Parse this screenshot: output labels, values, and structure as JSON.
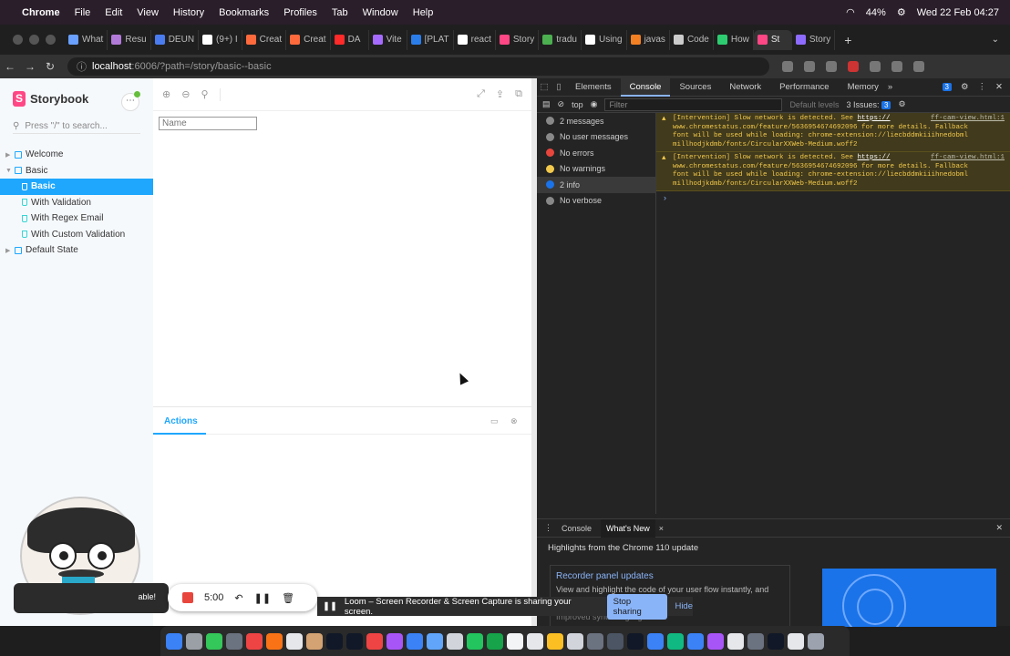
{
  "menubar": {
    "app": "Chrome",
    "items": [
      "File",
      "Edit",
      "View",
      "History",
      "Bookmarks",
      "Profiles",
      "Tab",
      "Window",
      "Help"
    ],
    "battery": "44%",
    "datetime": "Wed 22 Feb  04:27"
  },
  "tabs": [
    {
      "label": "What",
      "color": "#6aa0ff"
    },
    {
      "label": "Resu",
      "color": "#b27ad8"
    },
    {
      "label": "DEUN",
      "color": "#4a7cf0"
    },
    {
      "label": "(9+) I",
      "color": "#ffffff"
    },
    {
      "label": "Creat",
      "color": "#ff6a3d"
    },
    {
      "label": "Creat",
      "color": "#ff6a3d"
    },
    {
      "label": "DA",
      "color": "#ff2a2a"
    },
    {
      "label": "Vite",
      "color": "#a56bff"
    },
    {
      "label": "[PLAT",
      "color": "#2b7de9"
    },
    {
      "label": "react",
      "color": "#ffffff"
    },
    {
      "label": "Story",
      "color": "#ff4785"
    },
    {
      "label": "tradu",
      "color": "#4caf50"
    },
    {
      "label": "Using",
      "color": "#ffffff"
    },
    {
      "label": "javas",
      "color": "#f48024"
    },
    {
      "label": "Code",
      "color": "#cccccc"
    },
    {
      "label": "How",
      "color": "#2ecc71"
    },
    {
      "label": "St",
      "color": "#ff4785",
      "active": true
    },
    {
      "label": "Story",
      "color": "#8e6bff"
    }
  ],
  "address": {
    "host": "localhost",
    "rest": ":6006/?path=/story/basic--basic"
  },
  "storybook": {
    "brand": "Storybook",
    "search_placeholder": "Press \"/\" to search...",
    "tree": [
      {
        "label": "Welcome",
        "level": 0
      },
      {
        "label": "Basic",
        "level": 0,
        "open": true
      },
      {
        "label": "Basic",
        "level": 1,
        "selected": true
      },
      {
        "label": "With Validation",
        "level": 1
      },
      {
        "label": "With Regex Email",
        "level": 1
      },
      {
        "label": "With Custom Validation",
        "level": 1
      },
      {
        "label": "Default State",
        "level": 0
      }
    ],
    "name_placeholder": "Name",
    "addons_tab": "Actions"
  },
  "devtools": {
    "tabs": [
      "Elements",
      "Console",
      "Sources",
      "Network",
      "Performance",
      "Memory"
    ],
    "active_tab": "Console",
    "badge_count": "3",
    "context": "top",
    "filter_placeholder": "Filter",
    "levels": "Default levels",
    "issues": "3 Issues:",
    "issues_count": "3",
    "sidebar": [
      {
        "label": "2 messages",
        "icon": "#888"
      },
      {
        "label": "No user messages",
        "icon": "#888"
      },
      {
        "label": "No errors",
        "icon": "#e8453c"
      },
      {
        "label": "No warnings",
        "icon": "#f2c94c"
      },
      {
        "label": "2 info",
        "icon": "#1a73e8"
      },
      {
        "label": "No verbose",
        "icon": "#888"
      }
    ],
    "logs": [
      {
        "line1": "[Intervention] Slow network is detected. See ",
        "link": "https://",
        "src": "ff-cam-view.html:1",
        "line2": "www.chromestatus.com/feature/5636954674692096 for more details. Fallback",
        "line3": "font will be used while loading: chrome-extension://liecbddmkiiihnedobml",
        "line4": "millhodjkdmb/fonts/CircularXXWeb-Medium.woff2"
      },
      {
        "line1": "[Intervention] Slow network is detected. See ",
        "link": "https://",
        "src": "ff-cam-view.html:1",
        "line2": "www.chromestatus.com/feature/5636954674692096 for more details. Fallback",
        "line3": "font will be used while loading: chrome-extension://liecbddmkiiihnedobml",
        "line4": "millhodjkdmb/fonts/CircularXXWeb-Medium.woff2"
      }
    ],
    "drawer_tabs": [
      "Console",
      "What's New"
    ],
    "drawer_active": "What's New",
    "highlights": "Highlights from the Chrome 110 update",
    "card_title": "Recorder panel updates",
    "card_desc": "View and highlight the code of your user flow instantly, and",
    "card_next": "Improved syntax highlights"
  },
  "recorder": {
    "time": "5:00",
    "mascot_label": "able!"
  },
  "share": {
    "message": "Loom – Screen Recorder & Screen Capture is sharing your screen.",
    "stop": "Stop sharing",
    "hide": "Hide"
  },
  "dock_colors": [
    "#3b82f6",
    "#9aa0a6",
    "#34c759",
    "#6b7280",
    "#ef4444",
    "#f97316",
    "#e5e7eb",
    "#d4a373",
    "#111827",
    "#111827",
    "#ef4444",
    "#a855f7",
    "#3b82f6",
    "#60a5fa",
    "#d1d5db",
    "#22c55e",
    "#16a34a",
    "#f3f4f6",
    "#e5e7eb",
    "#fbbf24",
    "#d1d5db",
    "#6b7280",
    "#4b5563",
    "#111827",
    "#3b82f6",
    "#10b981",
    "#3b82f6",
    "#a855f7",
    "#e5e7eb",
    "#6b7280",
    "#111827",
    "#e5e7eb",
    "#9ca3af"
  ]
}
